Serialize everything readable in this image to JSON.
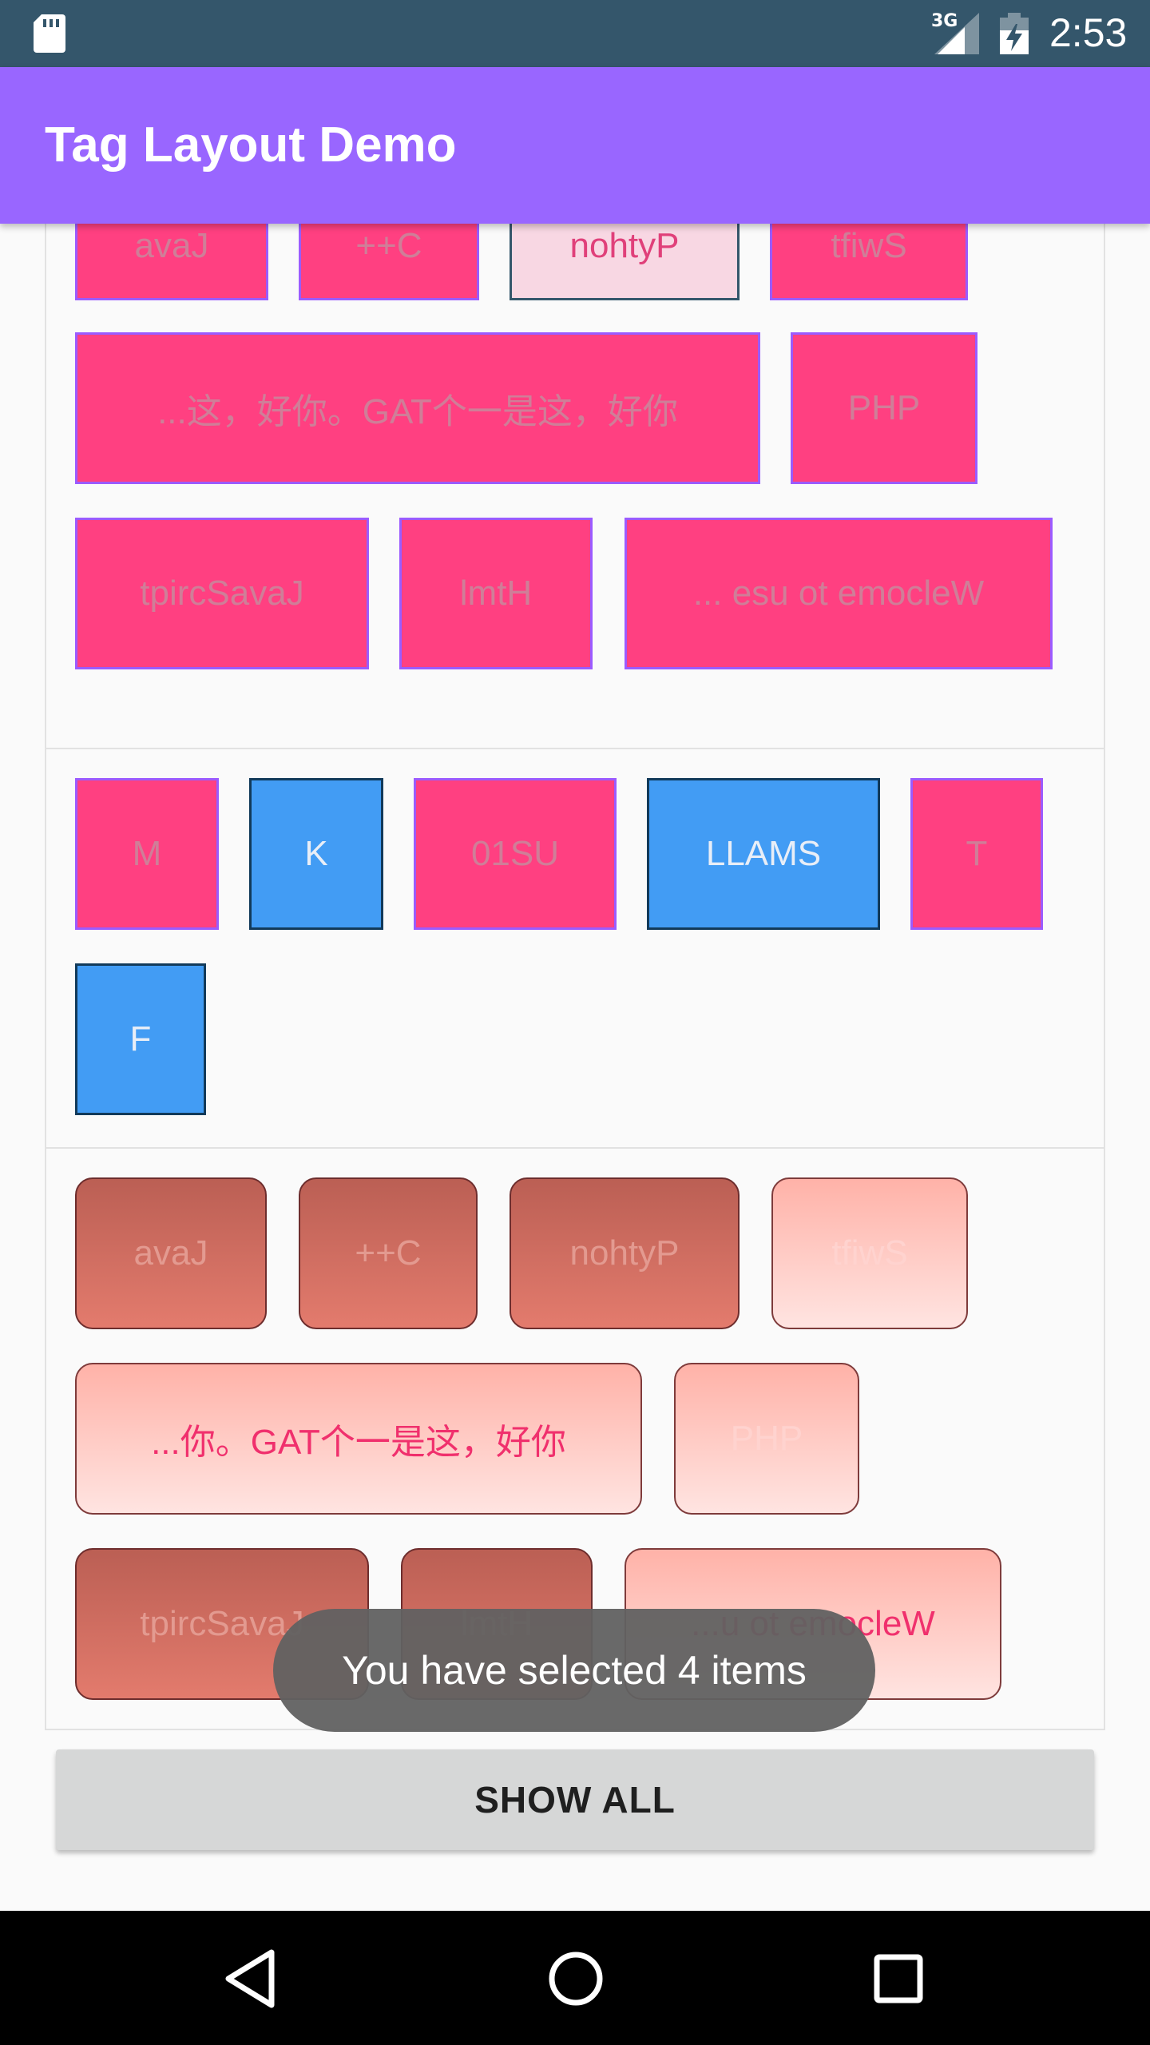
{
  "status_bar": {
    "network": "3G",
    "time": "2:53",
    "icons": [
      "sd-card-icon",
      "signal-icon",
      "battery-icon"
    ]
  },
  "app_bar": {
    "title": "Tag Layout Demo",
    "color": "#9966ff"
  },
  "group1": {
    "tags": [
      {
        "label": "avaJ"
      },
      {
        "label": "++C"
      },
      {
        "label": "nohtyP"
      },
      {
        "label": "tfiwS"
      },
      {
        "label": "...这，好你。GAT个一是这，好你"
      },
      {
        "label": "PHP"
      },
      {
        "label": "tpircSavaJ"
      },
      {
        "label": "lmtH"
      },
      {
        "label": "... esu ot emocleW"
      }
    ]
  },
  "group2": {
    "tags": [
      {
        "label": "M"
      },
      {
        "label": "K"
      },
      {
        "label": "01SU"
      },
      {
        "label": "LLAMS"
      },
      {
        "label": "T"
      },
      {
        "label": "F"
      }
    ]
  },
  "group3": {
    "tags": [
      {
        "label": "avaJ"
      },
      {
        "label": "++C"
      },
      {
        "label": "nohtyP"
      },
      {
        "label": "tfiwS"
      },
      {
        "label": "...你。GAT个一是这，好你"
      },
      {
        "label": "PHP"
      },
      {
        "label": "tpircSavaJ"
      },
      {
        "label": "lmtH"
      },
      {
        "label": "...u ot emocleW"
      }
    ]
  },
  "toast": {
    "message": "You have selected 4 items"
  },
  "button": {
    "label": "SHOW ALL"
  },
  "nav_bar": {
    "icons": [
      "back-icon",
      "home-icon",
      "recents-icon"
    ]
  },
  "colors": {
    "tag_pink": "#ff4081",
    "tag_blue": "#429cf4",
    "status_bar": "#34566b"
  }
}
